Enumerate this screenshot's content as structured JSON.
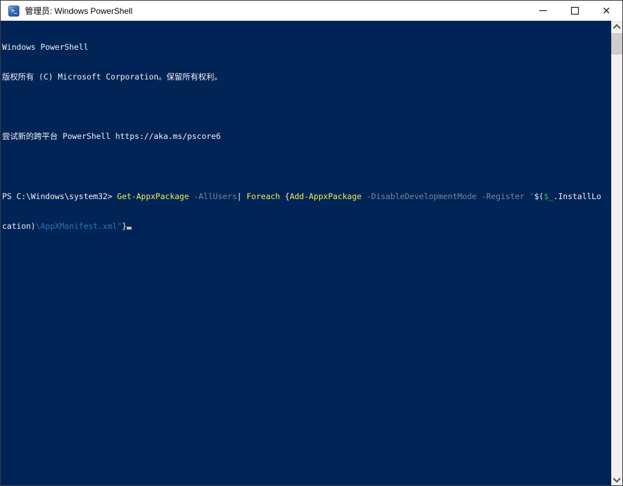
{
  "window": {
    "title": "管理员: Windows PowerShell",
    "icon": "powershell-icon",
    "controls": {
      "minimize": "minimize-icon",
      "maximize": "maximize-icon",
      "close": "close-icon"
    }
  },
  "console": {
    "output": [
      {
        "text": "Windows PowerShell"
      },
      {
        "text": "版权所有 (C) Microsoft Corporation。保留所有权利。"
      },
      {
        "text": ""
      },
      {
        "text": "尝试新的跨平台 PowerShell https://aka.ms/pscore6"
      },
      {
        "text": ""
      }
    ],
    "prompt": "PS C:\\Windows\\system32> ",
    "command_full": "Get-AppxPackage -AllUsers| Foreach {Add-AppxPackage -DisableDevelopmentMode -Register \"$($_.InstallLocation)\\AppXManifest.xml\"}",
    "command": {
      "line1": [
        {
          "text": "PS C:\\Windows\\system32> ",
          "role": "prompt"
        },
        {
          "text": "Get-AppxPackage ",
          "role": "command"
        },
        {
          "text": "-AllUsers",
          "role": "parameter"
        },
        {
          "text": "| ",
          "role": "operator"
        },
        {
          "text": "Foreach",
          "role": "command"
        },
        {
          "text": " {",
          "role": "brace"
        },
        {
          "text": "Add-AppxPackage ",
          "role": "command"
        },
        {
          "text": "-DisableDevelopmentMode -Register ",
          "role": "parameter"
        },
        {
          "text": "\"",
          "role": "string"
        },
        {
          "text": "$(",
          "role": "operator"
        },
        {
          "text": "$_",
          "role": "variable"
        },
        {
          "text": ".InstallLo",
          "role": "member"
        }
      ],
      "line2": [
        {
          "text": "cation)",
          "role": "member"
        },
        {
          "text": "\\AppXManifest.xml\"",
          "role": "string"
        },
        {
          "text": "}",
          "role": "brace"
        }
      ]
    }
  },
  "scrollbar": {
    "up_icon": "chevron-up-icon",
    "down_icon": "chevron-down-icon",
    "thumb_position": "top"
  },
  "palette": {
    "background": "#012456",
    "foreground": "#f0eff2",
    "command": "#edee54",
    "parameter": "#7b8399",
    "string": "#2d74ac",
    "variable": "#2bc24a",
    "cursor": "#c9c6b8",
    "titlebar_bg": "#ffffff",
    "titlebar_fg": "#000000",
    "scrollbar_track": "#f0f0f0",
    "scrollbar_thumb": "#cdcdcd"
  }
}
